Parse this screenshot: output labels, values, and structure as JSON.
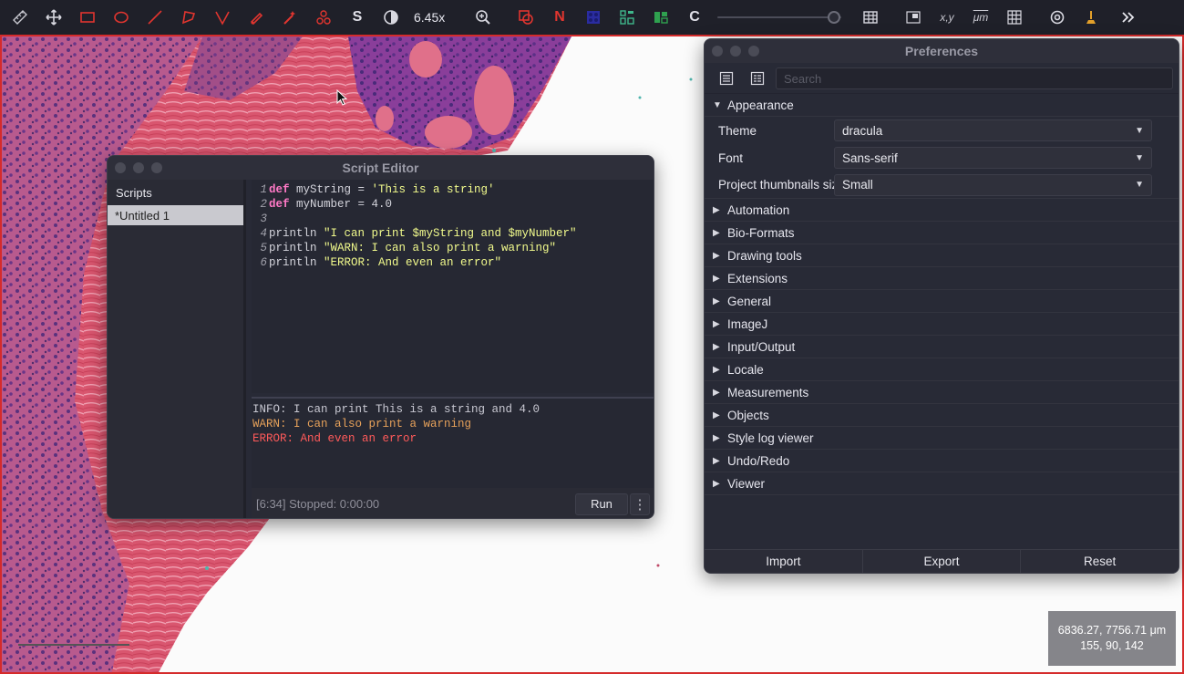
{
  "toolbar": {
    "tools": [
      {
        "icon": "ruler-icon"
      },
      {
        "icon": "move-icon"
      },
      {
        "icon": "rectangle-icon"
      },
      {
        "icon": "ellipse-icon"
      },
      {
        "icon": "line-icon"
      },
      {
        "icon": "polygon-icon"
      },
      {
        "icon": "polyline-icon"
      },
      {
        "icon": "brush-icon"
      },
      {
        "icon": "wand-icon"
      },
      {
        "icon": "points-icon"
      }
    ],
    "selection_mode_label": "S",
    "zoom_value": "6.45x",
    "counter_label": "N",
    "channel_label": "C",
    "xy_label": "x,y",
    "um_label": "μm"
  },
  "viewer": {
    "coords_line1": "6836.27, 7756.71 μm",
    "coords_line2": "155, 90, 142"
  },
  "script_editor": {
    "title": "Script Editor",
    "scripts_header": "Scripts",
    "scripts": [
      "*Untitled 1"
    ],
    "code_lines": [
      {
        "n": "1",
        "kw": "def",
        "text": " myString = ",
        "str": "'This is a string'"
      },
      {
        "n": "2",
        "kw": "def",
        "text": " myNumber = 4.0",
        "str": ""
      },
      {
        "n": "3",
        "kw": "",
        "text": "",
        "str": ""
      },
      {
        "n": "4",
        "kw": "",
        "text": "println ",
        "str": "\"I can print $myString and $myNumber\""
      },
      {
        "n": "5",
        "kw": "",
        "text": "println ",
        "str": "\"WARN: I can also print a warning\""
      },
      {
        "n": "6",
        "kw": "",
        "text": "println ",
        "str": "\"ERROR: And even an error\""
      }
    ],
    "console": {
      "info": "INFO: I can print This is a string and 4.0",
      "warn": "WARN: I can also print a warning",
      "error": "ERROR: And even an error"
    },
    "status": "[6:34]  Stopped: 0:00:00",
    "run_label": "Run",
    "more_label": "⋮"
  },
  "preferences": {
    "title": "Preferences",
    "search_placeholder": "Search",
    "appearance_label": "Appearance",
    "theme_label": "Theme",
    "theme_value": "dracula",
    "font_label": "Font",
    "font_value": "Sans-serif",
    "thumb_label": "Project thumbnails size",
    "thumb_value": "Small",
    "sections": [
      "Automation",
      "Bio-Formats",
      "Drawing tools",
      "Extensions",
      "General",
      "ImageJ",
      "Input/Output",
      "Locale",
      "Measurements",
      "Objects",
      "Style log viewer",
      "Undo/Redo",
      "Viewer"
    ],
    "import_label": "Import",
    "export_label": "Export",
    "reset_label": "Reset"
  }
}
